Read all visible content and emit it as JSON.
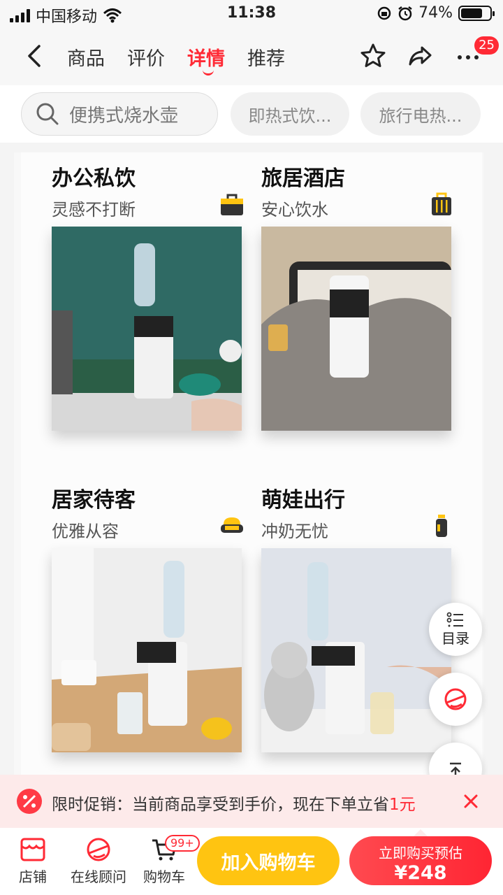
{
  "status_bar": {
    "carrier": "中国移动",
    "time": "11:38",
    "battery": "74%",
    "battery_level": 0.74,
    "icons": [
      "signal-icon",
      "wifi-icon",
      "rotation-lock-icon",
      "alarm-icon",
      "battery-icon"
    ]
  },
  "nav": {
    "tabs": [
      {
        "label": "商品",
        "active": false
      },
      {
        "label": "评价",
        "active": false
      },
      {
        "label": "详情",
        "active": true
      },
      {
        "label": "推荐",
        "active": false
      }
    ],
    "icons": [
      "back-icon",
      "star-icon",
      "share-icon",
      "more-icon"
    ],
    "more_badge": "25"
  },
  "search": {
    "placeholder": "便携式烧水壶",
    "chips": [
      "即热式饮...",
      "旅行电热..."
    ]
  },
  "cards": [
    {
      "title": "办公私饮",
      "subtitle": "灵感不打断",
      "icon": "briefcase-icon"
    },
    {
      "title": "旅居酒店",
      "subtitle": "安心饮水",
      "icon": "luggage-icon"
    },
    {
      "title": "居家待客",
      "subtitle": "优雅从容",
      "icon": "sofa-icon"
    },
    {
      "title": "萌娃出行",
      "subtitle": "冲奶无忧",
      "icon": "baby-bottle-icon"
    }
  ],
  "floating": {
    "catalog_label": "目录",
    "icons": [
      "list-icon",
      "customer-service-icon",
      "back-to-top-icon"
    ]
  },
  "promo": {
    "text": "限时促销：当前商品享受到手价，现在下单立省",
    "amount": "1元",
    "icons": [
      "discount-icon",
      "close-icon"
    ]
  },
  "bottom_bar": {
    "shop": "店铺",
    "consult": "在线顾问",
    "cart": "购物车",
    "cart_badge": "99+",
    "add_to_cart": "加入购物车",
    "buy_now": "立即购买预估",
    "price": "¥248"
  },
  "colors": {
    "accent": "#ff2a35",
    "add_to_cart": "#ffc411",
    "promo_bg": "#fdeaea"
  }
}
